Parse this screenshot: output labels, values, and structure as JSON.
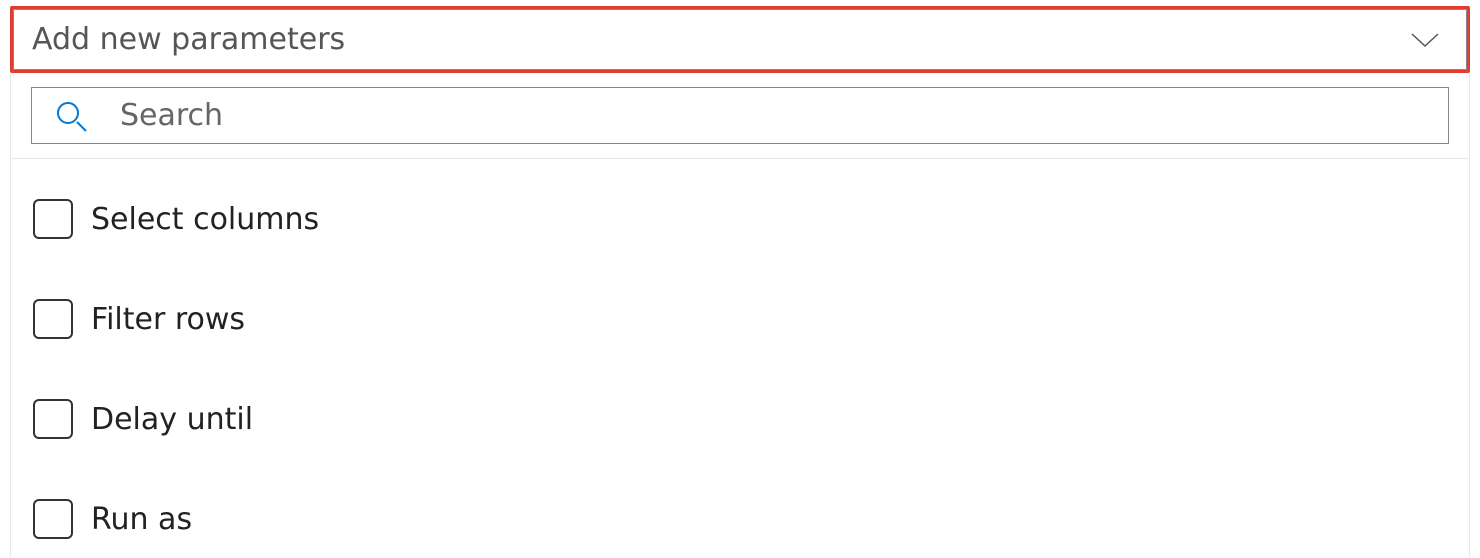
{
  "dropdown": {
    "placeholder": "Add new parameters"
  },
  "search": {
    "placeholder": "Search"
  },
  "options": [
    {
      "label": "Select columns"
    },
    {
      "label": "Filter rows"
    },
    {
      "label": "Delay until"
    },
    {
      "label": "Run as"
    }
  ]
}
